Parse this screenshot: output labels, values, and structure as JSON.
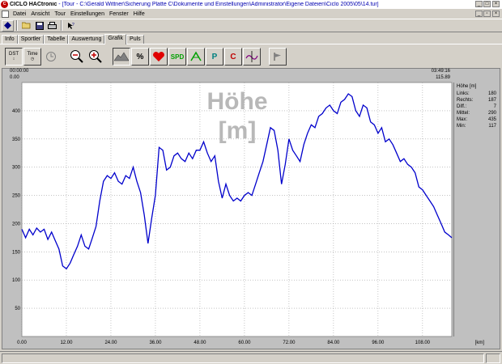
{
  "window": {
    "app_name": "CICLO HACtronic",
    "title_rest": " - [Tour - C:\\Gerald Wittner\\Sicherung Platte C\\Dokumente und Einstellungen\\Administrator\\Eigene Dateien\\Ciclo 2005\\05\\14.tur]"
  },
  "menu": [
    "Datei",
    "Ansicht",
    "Tour",
    "Einstellungen",
    "Fenster",
    "Hilfe"
  ],
  "tabs": [
    "Info",
    "Sportler",
    "Tabelle",
    "Auswertung",
    "Grafik",
    "Puls"
  ],
  "active_tab": "Grafik",
  "graph_buttons": {
    "dst": "DST",
    "time": "Time",
    "spd": "SPD",
    "pct": "%",
    "p": "P",
    "c": "C"
  },
  "time_left": {
    "start": "00:00:00",
    "sub": "0.00"
  },
  "time_right": {
    "end": "03:49:16",
    "sub": "115.89"
  },
  "panel": {
    "title": "Höhe [m]",
    "rows": [
      {
        "label": "Links:",
        "value": "180"
      },
      {
        "label": "Rechts:",
        "value": "187"
      },
      {
        "label": "Diff.:",
        "value": "7"
      },
      {
        "label": "Mittel:",
        "value": "290"
      },
      {
        "label": "Max:",
        "value": "435"
      },
      {
        "label": "Min:",
        "value": "117"
      }
    ]
  },
  "colors": {
    "line": "#0000cc",
    "watermark": "#b8b8b8",
    "grid": "#a0a0a0"
  },
  "chart_data": {
    "type": "line",
    "title": "Höhe [m]",
    "xlabel": "[km]",
    "ylabel": "",
    "xlim": [
      0,
      115.89
    ],
    "ylim": [
      0,
      450
    ],
    "x_ticks": [
      0,
      12,
      24,
      36,
      48,
      60,
      72,
      84,
      96,
      108
    ],
    "x_tick_labels": [
      "0.00",
      "12.00",
      "24.00",
      "36.00",
      "48.00",
      "60.00",
      "72.00",
      "84.00",
      "96.00",
      "108.00"
    ],
    "y_ticks": [
      50,
      100,
      150,
      200,
      250,
      300,
      350,
      400
    ],
    "grid": true,
    "series": [
      {
        "name": "Höhe",
        "x": [
          0,
          1,
          2,
          3,
          4,
          5,
          6,
          7,
          8,
          9,
          10,
          11,
          12,
          13,
          14,
          15,
          16,
          17,
          18,
          19,
          20,
          21,
          22,
          23,
          24,
          25,
          26,
          27,
          28,
          29,
          30,
          31,
          32,
          33,
          34,
          35,
          36,
          37,
          38,
          39,
          40,
          41,
          42,
          43,
          44,
          45,
          46,
          47,
          48,
          49,
          50,
          51,
          52,
          53,
          54,
          55,
          56,
          57,
          58,
          59,
          60,
          61,
          62,
          63,
          64,
          65,
          66,
          67,
          68,
          69,
          70,
          71,
          72,
          73,
          74,
          75,
          76,
          77,
          78,
          79,
          80,
          81,
          82,
          83,
          84,
          85,
          86,
          87,
          88,
          89,
          90,
          91,
          92,
          93,
          94,
          95,
          96,
          97,
          98,
          99,
          100,
          101,
          102,
          103,
          104,
          105,
          106,
          107,
          108,
          109,
          110,
          111,
          112,
          113,
          114,
          115,
          115.89
        ],
        "y": [
          190,
          175,
          190,
          180,
          192,
          185,
          190,
          172,
          185,
          170,
          155,
          125,
          120,
          130,
          145,
          160,
          180,
          160,
          155,
          175,
          195,
          240,
          275,
          285,
          280,
          290,
          275,
          270,
          285,
          280,
          300,
          275,
          255,
          215,
          165,
          210,
          250,
          335,
          330,
          295,
          300,
          320,
          325,
          315,
          310,
          325,
          315,
          330,
          330,
          345,
          325,
          310,
          320,
          275,
          245,
          270,
          250,
          240,
          245,
          240,
          250,
          255,
          250,
          270,
          290,
          310,
          340,
          370,
          365,
          330,
          270,
          305,
          350,
          330,
          320,
          310,
          340,
          360,
          375,
          370,
          390,
          395,
          405,
          410,
          400,
          395,
          415,
          420,
          430,
          425,
          400,
          390,
          410,
          405,
          380,
          375,
          360,
          370,
          345,
          350,
          340,
          325,
          310,
          315,
          305,
          300,
          290,
          265,
          260,
          250,
          240,
          230,
          215,
          200,
          185,
          180,
          175
        ]
      }
    ]
  }
}
